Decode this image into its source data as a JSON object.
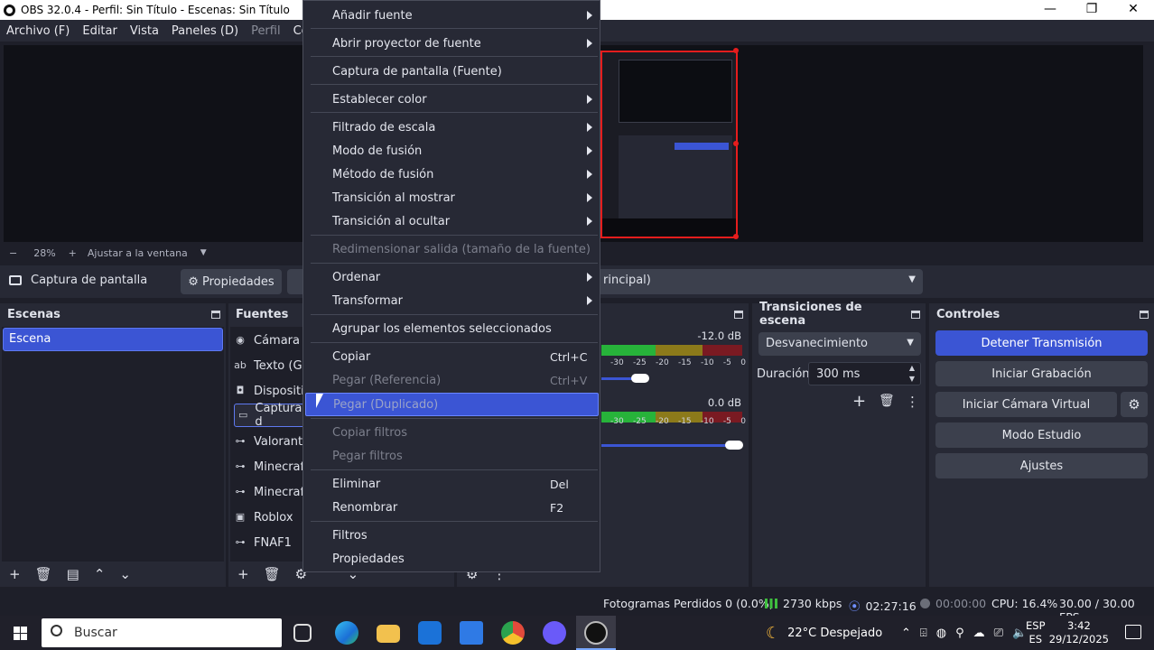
{
  "window": {
    "title": "OBS 32.0.4 - Perfil: Sin Título - Escenas: Sin Título",
    "minimize": "—",
    "maximize": "❐",
    "close": "✕"
  },
  "menubar": [
    "Archivo (F)",
    "Editar",
    "Vista",
    "Paneles (D)",
    "Perfil",
    "Colección"
  ],
  "preview": {
    "zoom_minus": "−",
    "zoom": "28%",
    "zoom_plus": "+",
    "fit_label": "Ajustar a la ventana"
  },
  "source_toolbar": {
    "selected_source": "Captura de pantalla",
    "properties_label": "Propiedades",
    "scene_select_value": "rincipal)"
  },
  "docks": {
    "scenes": {
      "title": "Escenas",
      "items": [
        "Escena"
      ]
    },
    "sources": {
      "title": "Fuentes",
      "items": [
        {
          "label": "Cámara c",
          "icon": "camera-icon"
        },
        {
          "label": "Texto (GD",
          "icon": "text-icon"
        },
        {
          "label": "Dispositi",
          "icon": "device-icon"
        },
        {
          "label": "Captura d",
          "icon": "monitor-icon"
        },
        {
          "label": "Valorant",
          "icon": "gamepad-icon"
        },
        {
          "label": "Minecraf",
          "icon": "gamepad-icon"
        },
        {
          "label": "Minecraf",
          "icon": "gamepad-icon"
        },
        {
          "label": "Roblox",
          "icon": "window-icon"
        },
        {
          "label": "FNAF1",
          "icon": "gamepad-icon"
        }
      ]
    },
    "mixer": {
      "track1_db": "-12.0 dB",
      "track2_db": "0.0 dB",
      "ticks": [
        "-30",
        "-25",
        "-20",
        "-15",
        "-10",
        "-5",
        "0"
      ]
    },
    "transitions": {
      "title": "Transiciones de escena",
      "selected": "Desvanecimiento",
      "duration_label": "Duración",
      "duration_value": "300 ms"
    },
    "controls": {
      "title": "Controles",
      "buttons": [
        "Detener Transmisión",
        "Iniciar Grabación",
        "Iniciar Cámara Virtual",
        "Modo Estudio",
        "Ajustes"
      ]
    }
  },
  "context_menu": {
    "items": [
      {
        "label": "Añadir fuente",
        "submenu": true
      },
      {
        "label": "Abrir proyector de fuente",
        "submenu": true
      },
      {
        "label": "Captura de pantalla (Fuente)"
      },
      {
        "label": "Establecer color",
        "submenu": true
      },
      {
        "label": "Filtrado de escala",
        "submenu": true
      },
      {
        "label": "Modo de fusión",
        "submenu": true
      },
      {
        "label": "Método de fusión",
        "submenu": true
      },
      {
        "label": "Transición al mostrar",
        "submenu": true
      },
      {
        "label": "Transición al ocultar",
        "submenu": true
      },
      {
        "label": "Redimensionar salida (tamaño de la fuente)",
        "disabled": true
      },
      {
        "label": "Ordenar",
        "submenu": true
      },
      {
        "label": "Transformar",
        "submenu": true
      },
      {
        "label": "Agrupar los elementos seleccionados"
      },
      {
        "label": "Copiar",
        "shortcut": "Ctrl+C"
      },
      {
        "label": "Pegar (Referencia)",
        "shortcut": "Ctrl+V",
        "disabled": true
      },
      {
        "label": "Pegar (Duplicado)",
        "disabled": true,
        "highlighted": true
      },
      {
        "label": "Copiar filtros",
        "disabled": true
      },
      {
        "label": "Pegar filtros",
        "disabled": true
      },
      {
        "label": "Eliminar",
        "shortcut": "Del"
      },
      {
        "label": "Renombrar",
        "shortcut": "F2"
      },
      {
        "label": "Filtros"
      },
      {
        "label": "Propiedades"
      }
    ]
  },
  "statusbar": {
    "dropped_frames": "Fotogramas Perdidos 0 (0.0%)",
    "bitrate": "2730 kbps",
    "stream_time": "02:27:16",
    "rec_time": "00:00:00",
    "cpu": "CPU: 16.4%",
    "fps": "30.00 / 30.00 FPS"
  },
  "taskbar": {
    "search_placeholder": "Buscar",
    "weather": "22°C  Despejado",
    "lang_top": "ESP",
    "lang_bottom": "ES",
    "time": "3:42",
    "date": "29/12/2025"
  },
  "colors": {
    "accent": "#3b55d4",
    "panel": "#272935",
    "background": "#1e1f29",
    "selection_border": "#e51d1d"
  }
}
